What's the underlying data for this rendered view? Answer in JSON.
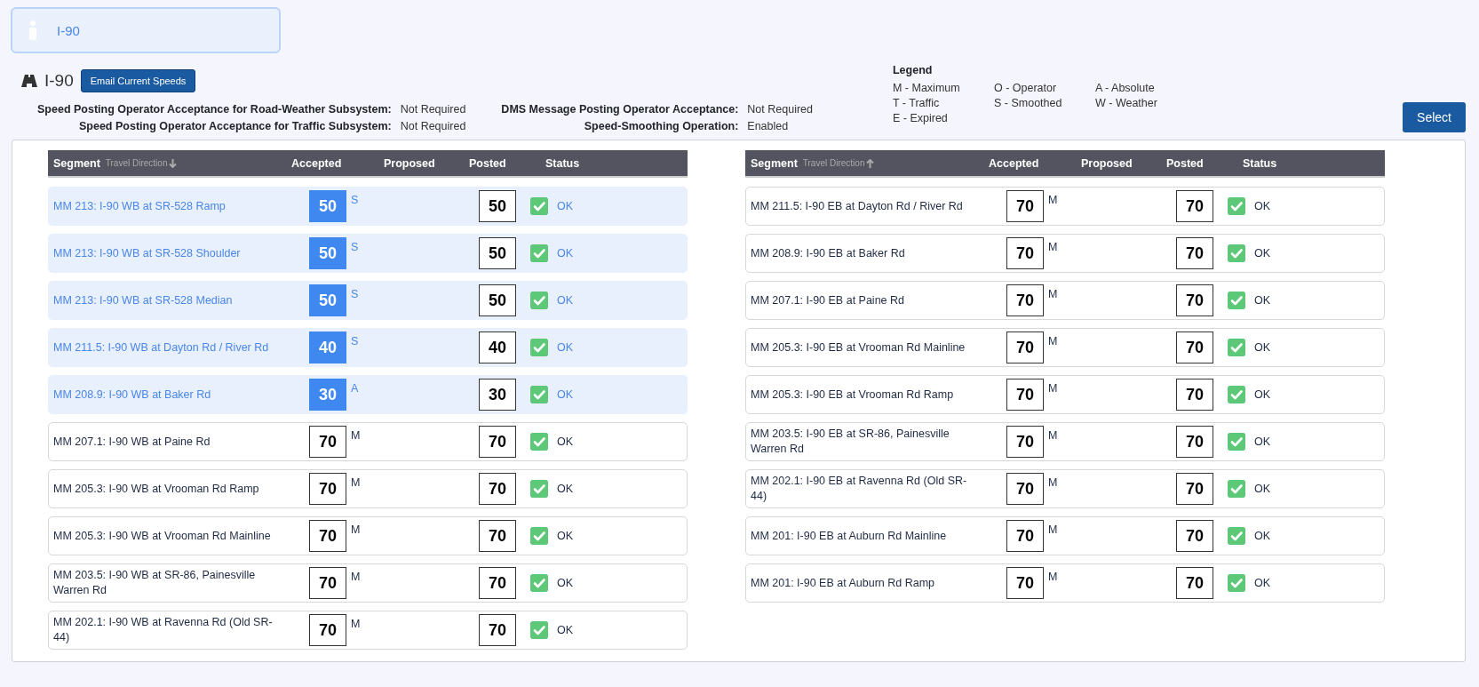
{
  "info_card": {
    "title": "I-90"
  },
  "header": {
    "road": "I-90",
    "email_button": "Email Current Speeds"
  },
  "settings": [
    {
      "label": "Speed Posting Operator Acceptance for Road-Weather Subsystem:",
      "value": "Not Required"
    },
    {
      "label": "DMS Message Posting Operator Acceptance:",
      "value": "Not Required"
    },
    {
      "label": "Speed Posting Operator Acceptance for Traffic Subsystem:",
      "value": "Not Required"
    },
    {
      "label": "Speed-Smoothing Operation:",
      "value": "Enabled"
    }
  ],
  "legend": {
    "title": "Legend",
    "columns": [
      [
        "M - Maximum",
        "T - Traffic",
        "E - Expired"
      ],
      [
        "O - Operator",
        "S - Smoothed"
      ],
      [
        "A - Absolute",
        "W - Weather"
      ]
    ]
  },
  "select_button": "Select",
  "tables": [
    {
      "columns": {
        "segment": "Segment",
        "direction": "Travel Direction",
        "accepted": "Accepted",
        "proposed": "Proposed",
        "posted": "Posted",
        "status": "Status"
      },
      "sort_ascending": false,
      "rows": [
        {
          "segment": "MM 213: I-90 WB at SR-528 Ramp",
          "selected": true,
          "accepted": "50",
          "code": "S",
          "posted": "50",
          "ok": true,
          "status": "OK"
        },
        {
          "segment": "MM 213: I-90 WB at SR-528 Shoulder",
          "selected": true,
          "accepted": "50",
          "code": "S",
          "posted": "50",
          "ok": true,
          "status": "OK"
        },
        {
          "segment": "MM 213: I-90 WB at SR-528 Median",
          "selected": true,
          "accepted": "50",
          "code": "S",
          "posted": "50",
          "ok": true,
          "status": "OK"
        },
        {
          "segment": "MM 211.5: I-90 WB at Dayton Rd / River Rd",
          "selected": true,
          "accepted": "40",
          "code": "S",
          "posted": "40",
          "ok": true,
          "status": "OK"
        },
        {
          "segment": "MM 208.9: I-90 WB at Baker Rd",
          "selected": true,
          "accepted": "30",
          "code": "A",
          "posted": "30",
          "ok": true,
          "status": "OK"
        },
        {
          "segment": "MM 207.1: I-90 WB at Paine Rd",
          "selected": false,
          "accepted": "70",
          "code": "M",
          "posted": "70",
          "ok": true,
          "status": "OK"
        },
        {
          "segment": "MM 205.3: I-90 WB at Vrooman Rd Ramp",
          "selected": false,
          "accepted": "70",
          "code": "M",
          "posted": "70",
          "ok": true,
          "status": "OK"
        },
        {
          "segment": "MM 205.3: I-90 WB at Vrooman Rd Mainline",
          "selected": false,
          "accepted": "70",
          "code": "M",
          "posted": "70",
          "ok": true,
          "status": "OK"
        },
        {
          "segment": "MM 203.5: I-90 WB at SR-86, Painesville Warren Rd",
          "selected": false,
          "accepted": "70",
          "code": "M",
          "posted": "70",
          "ok": true,
          "status": "OK"
        },
        {
          "segment": "MM 202.1: I-90 WB at Ravenna Rd (Old SR-44)",
          "selected": false,
          "accepted": "70",
          "code": "M",
          "posted": "70",
          "ok": true,
          "status": "OK"
        }
      ]
    },
    {
      "columns": {
        "segment": "Segment",
        "direction": "Travel Direction",
        "accepted": "Accepted",
        "proposed": "Proposed",
        "posted": "Posted",
        "status": "Status"
      },
      "sort_ascending": true,
      "rows": [
        {
          "segment": "MM 211.5: I-90 EB at Dayton Rd / River Rd",
          "selected": false,
          "accepted": "70",
          "code": "M",
          "posted": "70",
          "ok": true,
          "status": "OK"
        },
        {
          "segment": "MM 208.9: I-90 EB at Baker Rd",
          "selected": false,
          "accepted": "70",
          "code": "M",
          "posted": "70",
          "ok": true,
          "status": "OK"
        },
        {
          "segment": "MM 207.1: I-90 EB at Paine Rd",
          "selected": false,
          "accepted": "70",
          "code": "M",
          "posted": "70",
          "ok": true,
          "status": "OK"
        },
        {
          "segment": "MM 205.3: I-90 EB at Vrooman Rd Mainline",
          "selected": false,
          "accepted": "70",
          "code": "M",
          "posted": "70",
          "ok": true,
          "status": "OK"
        },
        {
          "segment": "MM 205.3: I-90 EB at Vrooman Rd Ramp",
          "selected": false,
          "accepted": "70",
          "code": "M",
          "posted": "70",
          "ok": true,
          "status": "OK"
        },
        {
          "segment": "MM 203.5: I-90 EB at SR-86, Painesville Warren Rd",
          "selected": false,
          "accepted": "70",
          "code": "M",
          "posted": "70",
          "ok": true,
          "status": "OK"
        },
        {
          "segment": "MM 202.1: I-90 EB at Ravenna Rd (Old SR-44)",
          "selected": false,
          "accepted": "70",
          "code": "M",
          "posted": "70",
          "ok": true,
          "status": "OK"
        },
        {
          "segment": "MM 201: I-90 EB at Auburn Rd Mainline",
          "selected": false,
          "accepted": "70",
          "code": "M",
          "posted": "70",
          "ok": true,
          "status": "OK"
        },
        {
          "segment": "MM 201: I-90 EB at Auburn Rd Ramp",
          "selected": false,
          "accepted": "70",
          "code": "M",
          "posted": "70",
          "ok": true,
          "status": "OK"
        }
      ]
    }
  ]
}
